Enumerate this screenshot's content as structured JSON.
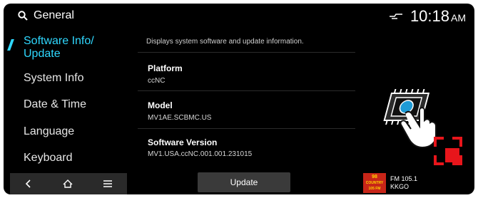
{
  "header": {
    "search_label": "General",
    "time": "10:18",
    "ampm": "AM"
  },
  "sidebar": {
    "items": [
      {
        "label": "Software Info/"
      },
      {
        "label": "Update"
      },
      {
        "label": "System Info"
      },
      {
        "label": "Date & Time"
      },
      {
        "label": "Language"
      },
      {
        "label": "Keyboard"
      }
    ]
  },
  "content": {
    "description": "Displays system software and update information.",
    "rows": [
      {
        "title": "Platform",
        "value": "ccNC"
      },
      {
        "title": "Model",
        "value": "MV1AE.SCBMC.US"
      },
      {
        "title": "Software Version",
        "value": "MV1.USA.ccNC.001.001.231015"
      }
    ]
  },
  "footer": {
    "update_label": "Update",
    "radio_logo_top": "98",
    "radio_logo_mid": "COUNTRY",
    "radio_logo_bottom": "105 FM",
    "radio_station": "FM 105.1",
    "radio_callsign": "KKGO"
  },
  "colors": {
    "accent": "#2fd8ff",
    "background": "#000000",
    "indicator_red": "#e8151b"
  }
}
